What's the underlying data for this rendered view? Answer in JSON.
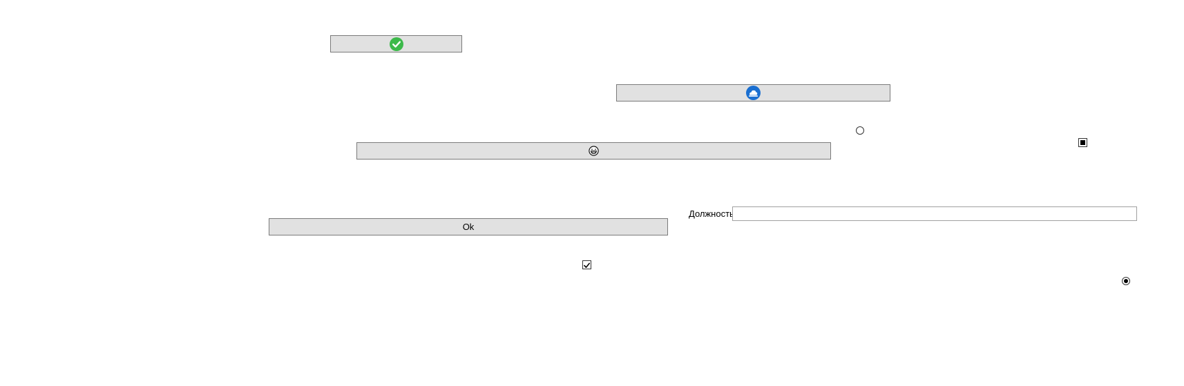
{
  "buttons": {
    "confirm": {
      "icon": "green-checkmark-icon",
      "color": "#3cb94a"
    },
    "cloud": {
      "icon": "cloud-circle-icon",
      "color": "#1a6fd1"
    },
    "emoji": {
      "icon": "grinning-face-icon"
    },
    "ok": {
      "label": "Ok"
    }
  },
  "form": {
    "position_label": "Должность",
    "position_value": "",
    "position_placeholder": ""
  },
  "controls": {
    "radio_top": {
      "checked": false
    },
    "checkbox_indeterminate": {
      "state": "indeterminate"
    },
    "checkbox_checked": {
      "checked": true
    },
    "radio_bottom": {
      "checked": true
    }
  }
}
